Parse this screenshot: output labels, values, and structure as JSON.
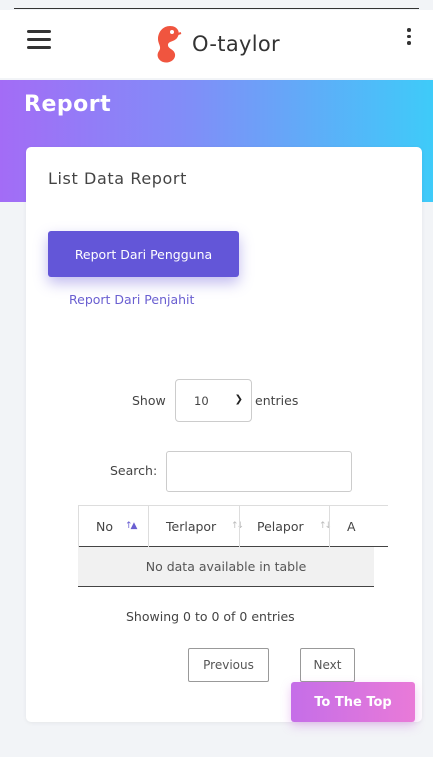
{
  "navbar": {
    "brand": "O-taylor",
    "icons": {
      "menu": "hamburger-menu-icon",
      "more": "more-vertical-icon",
      "logo": "seahorse-logo"
    },
    "logo_color": "#f0553f"
  },
  "hero": {
    "title": "Report",
    "gradient": [
      "#a36cf6",
      "#3ecbf9"
    ]
  },
  "card": {
    "title": "List Data Report",
    "tabs": [
      {
        "label": "Report Dari Pengguna",
        "active": true
      },
      {
        "label": "Report Dari Penjahit",
        "active": false
      }
    ]
  },
  "table_controls": {
    "show_label": "Show",
    "entries_value": "10",
    "entries_label": "entries",
    "search_label": "Search:",
    "search_value": ""
  },
  "table": {
    "columns": [
      "No",
      "Terlapor",
      "Pelapor",
      "A"
    ],
    "empty_message": "No data available in table"
  },
  "pagination": {
    "info": "Showing 0 to 0 of 0 entries",
    "previous": "Previous",
    "next": "Next"
  },
  "to_top": {
    "label": "To The Top"
  },
  "colors": {
    "primary": "#6356d8",
    "link": "#6a5fd1",
    "to_top": "#d974e0"
  }
}
